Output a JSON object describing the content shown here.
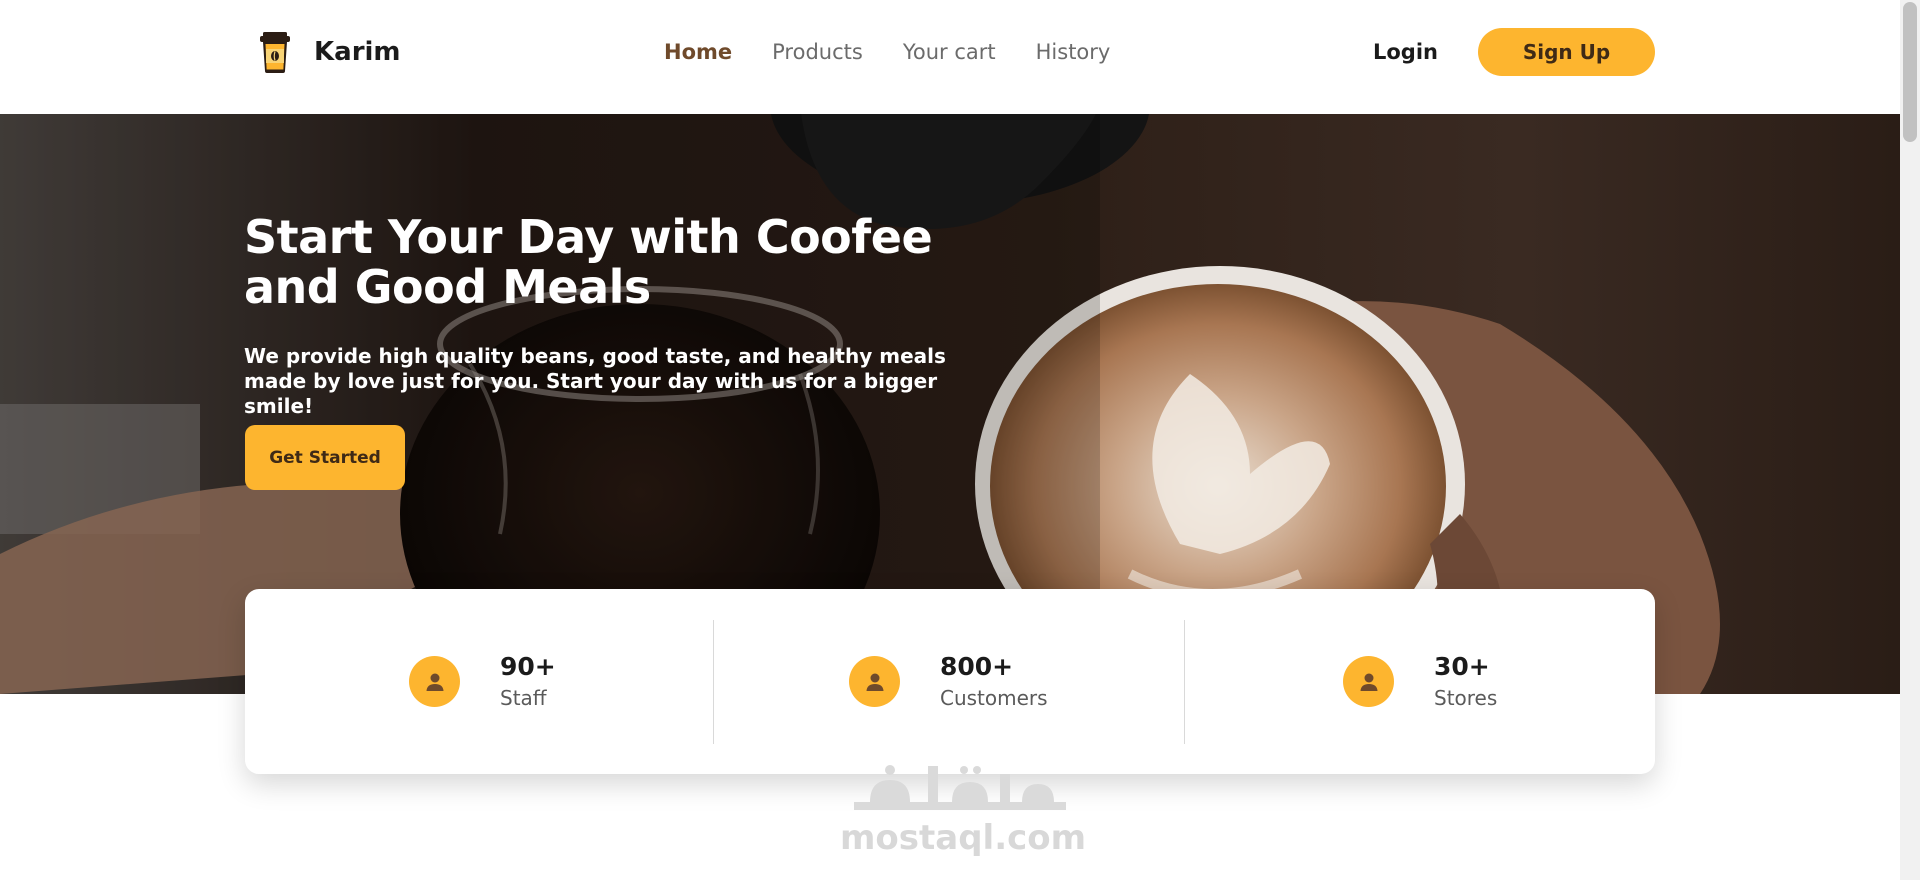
{
  "header": {
    "brand_name": "Karim",
    "nav": [
      {
        "label": "Home",
        "active": true
      },
      {
        "label": "Products",
        "active": false
      },
      {
        "label": "Your cart",
        "active": false
      },
      {
        "label": "History",
        "active": false
      }
    ],
    "login_label": "Login",
    "signup_label": "Sign Up"
  },
  "hero": {
    "title": "Start Your Day with Coofee and Good Meals",
    "subtitle": "We provide high quality beans, good taste, and healthy meals made by love just for you. Start your day with us for a bigger smile!",
    "cta_label": "Get Started"
  },
  "stats": [
    {
      "value": "90+",
      "label": "Staff",
      "icon": "user-icon"
    },
    {
      "value": "800+",
      "label": "Customers",
      "icon": "user-icon"
    },
    {
      "value": "30+",
      "label": "Stores",
      "icon": "user-icon"
    }
  ],
  "watermark": {
    "text": "mostaql.com"
  },
  "colors": {
    "accent": "#fdb52f",
    "brand_dark": "#6f4a2b",
    "text_dark": "#1b1b1b",
    "text_muted": "#6b6b6b"
  }
}
